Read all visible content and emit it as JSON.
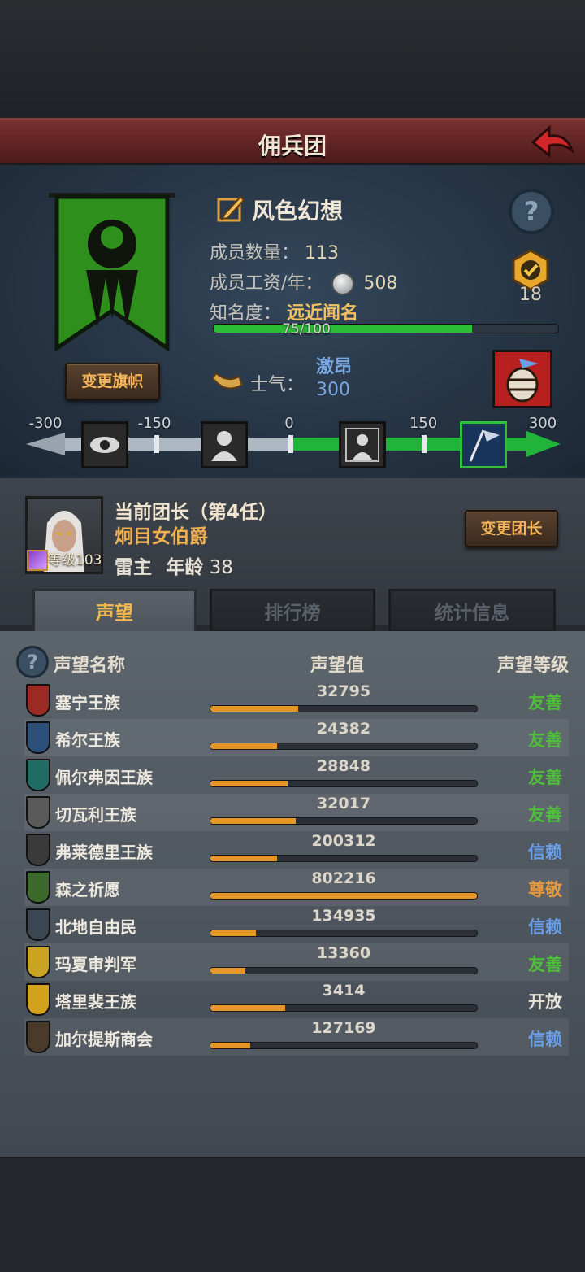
{
  "header": {
    "title": "佣兵团"
  },
  "guild": {
    "name": "风色幻想",
    "members_label": "成员数量：",
    "members": "113",
    "salary_label": "成员工资/年：",
    "salary": "508",
    "fame_label": "知名度：",
    "fame_state": "远近闻名",
    "fame_progress_text": "75/100",
    "fame_progress": 0.75,
    "medal_count": "18",
    "change_flag_label": "变更旗帜"
  },
  "morale": {
    "label": "士气：",
    "state": "激昂",
    "value": "300",
    "ticks": [
      "-300",
      "-150",
      "0",
      "150",
      "300"
    ],
    "level_fraction": 1.0
  },
  "leader": {
    "title": "当前团长（第4任）",
    "name": "炯目女伯爵",
    "level_label": "等级",
    "level": "103",
    "class": "雷主",
    "age_label": "年龄",
    "age": "38",
    "change_button": "变更团长"
  },
  "tabs": [
    {
      "label": "声望"
    },
    {
      "label": "排行榜"
    },
    {
      "label": "统计信息"
    }
  ],
  "list": {
    "col_name": "声望名称",
    "col_value": "声望值",
    "col_level": "声望等级",
    "rows": [
      {
        "name": "塞宁王族",
        "value": "32795",
        "level": "友善",
        "level_color": "#4fbe3a",
        "shield": "#9b2a22",
        "fraction": 0.33
      },
      {
        "name": "希尔王族",
        "value": "24382",
        "level": "友善",
        "level_color": "#4fbe3a",
        "shield": "#2c4f7a",
        "fraction": 0.25
      },
      {
        "name": "佩尔弗因王族",
        "value": "28848",
        "level": "友善",
        "level_color": "#4fbe3a",
        "shield": "#1f6c66",
        "fraction": 0.29
      },
      {
        "name": "切瓦利王族",
        "value": "32017",
        "level": "友善",
        "level_color": "#4fbe3a",
        "shield": "#5a5a5a",
        "fraction": 0.32
      },
      {
        "name": "弗莱德里王族",
        "value": "200312",
        "level": "信赖",
        "level_color": "#6a9ee6",
        "shield": "#3a3a3a",
        "fraction": 0.25
      },
      {
        "name": "森之祈愿",
        "value": "802216",
        "level": "尊敬",
        "level_color": "#e79a3c",
        "shield": "#3c6a2a",
        "fraction": 1.0
      },
      {
        "name": "北地自由民",
        "value": "134935",
        "level": "信赖",
        "level_color": "#6a9ee6",
        "shield": "#3a4652",
        "fraction": 0.17
      },
      {
        "name": "玛夏审判军",
        "value": "13360",
        "level": "友善",
        "level_color": "#4fbe3a",
        "shield": "#caa324",
        "fraction": 0.13
      },
      {
        "name": "塔里裴王族",
        "value": "3414",
        "level": "开放",
        "level_color": "#e9e4da",
        "shield": "#d2a21e",
        "fraction": 0.28
      },
      {
        "name": "加尔提斯商会",
        "value": "127169",
        "level": "信赖",
        "level_color": "#6a9ee6",
        "shield": "#4a3a2a",
        "fraction": 0.15
      }
    ]
  }
}
